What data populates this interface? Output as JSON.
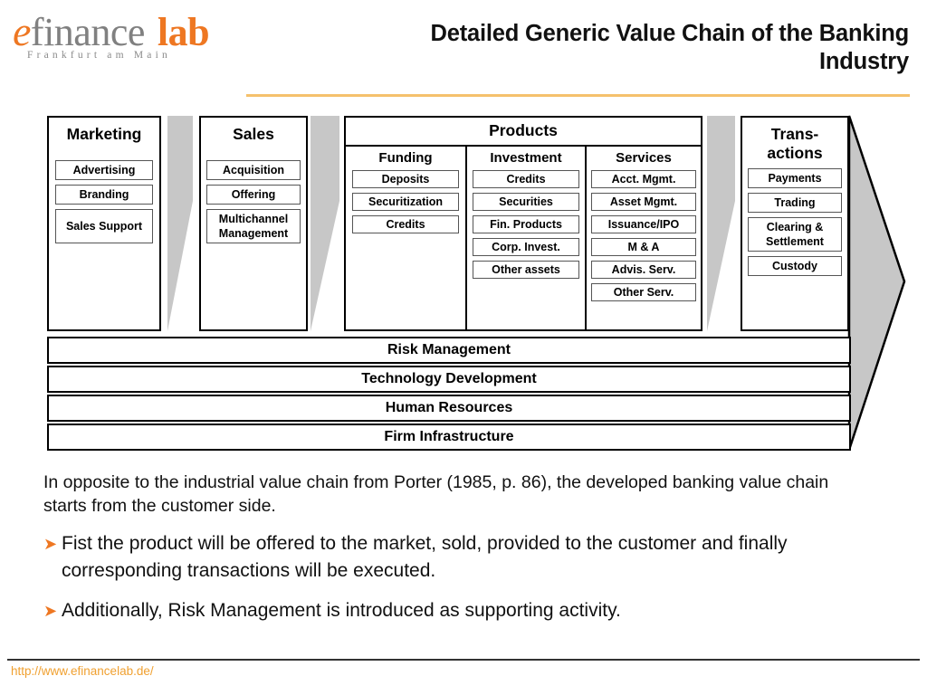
{
  "logo": {
    "e": "e",
    "finance": "finance",
    "lab": "lab",
    "subtitle": "Frankfurt am Main"
  },
  "title": "Detailed Generic Value Chain of the Banking Industry",
  "colors": {
    "accent_orange": "#ee7722",
    "rule_orange": "#f5c16c",
    "arrow_gray": "#c7c7c7",
    "url_orange": "#f0a030"
  },
  "diagram": {
    "primary_stages": [
      {
        "name": "Marketing",
        "items": [
          "Advertising",
          "Branding",
          "Sales Support"
        ]
      },
      {
        "name": "Sales",
        "items": [
          "Acquisition",
          "Offering",
          "Multichannel Management"
        ]
      },
      {
        "name": "Trans-actions",
        "items": [
          "Payments",
          "Trading",
          "Clearing & Settlement",
          "Custody"
        ]
      }
    ],
    "products": {
      "name": "Products",
      "columns": [
        {
          "name": "Funding",
          "items": [
            "Deposits",
            "Securitization",
            "Credits"
          ]
        },
        {
          "name": "Investment",
          "items": [
            "Credits",
            "Securities",
            "Fin. Products",
            "Corp. Invest.",
            "Other assets"
          ]
        },
        {
          "name": "Services",
          "items": [
            "Acct. Mgmt.",
            "Asset Mgmt.",
            "Issuance/IPO",
            "M & A",
            "Advis. Serv.",
            "Other Serv."
          ]
        }
      ]
    },
    "support_activities": [
      "Risk Management",
      "Technology Development",
      "Human Resources",
      "Firm Infrastructure"
    ]
  },
  "body": {
    "paragraph": "In opposite to the industrial value chain from Porter (1985, p. 86), the developed banking value chain starts from the customer side.",
    "bullets": [
      "Fist the product will be offered to the market, sold, provided to the customer  and finally corresponding transactions will be executed.",
      "Additionally, Risk Management is introduced as supporting activity."
    ],
    "bullet_glyph": "➤"
  },
  "footer": {
    "url": "http://www.efinancelab.de/"
  }
}
